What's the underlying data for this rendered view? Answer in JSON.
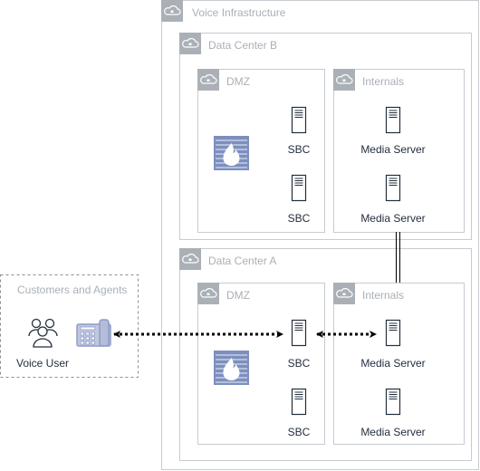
{
  "groups": {
    "voice_infrastructure": "Voice Infrastructure",
    "dc_b": "Data Center B",
    "dc_b_dmz": "DMZ",
    "dc_b_internals": "Internals",
    "dc_a": "Data Center A",
    "dc_a_dmz": "DMZ",
    "dc_a_internals": "Internals",
    "customers": "Customers and Agents"
  },
  "nodes": {
    "b_sbc1": "SBC",
    "b_sbc2": "SBC",
    "b_ms1": "Media Server",
    "b_ms2": "Media Server",
    "a_sbc1": "SBC",
    "a_sbc2": "SBC",
    "a_ms1": "Media Server",
    "a_ms2": "Media Server",
    "voice_user": "Voice User"
  },
  "icons": {
    "group": "cloud-lock-icon",
    "server": "server-icon",
    "firewall": "firewall-icon",
    "users": "users-icon",
    "phone": "desk-phone-icon"
  },
  "colors": {
    "group_border": "#c7cbd0",
    "group_tab": "#aab0b6",
    "icon_stroke": "#232f3e",
    "firewall": "#7d8fbd",
    "phone": "#8e9cc6"
  }
}
